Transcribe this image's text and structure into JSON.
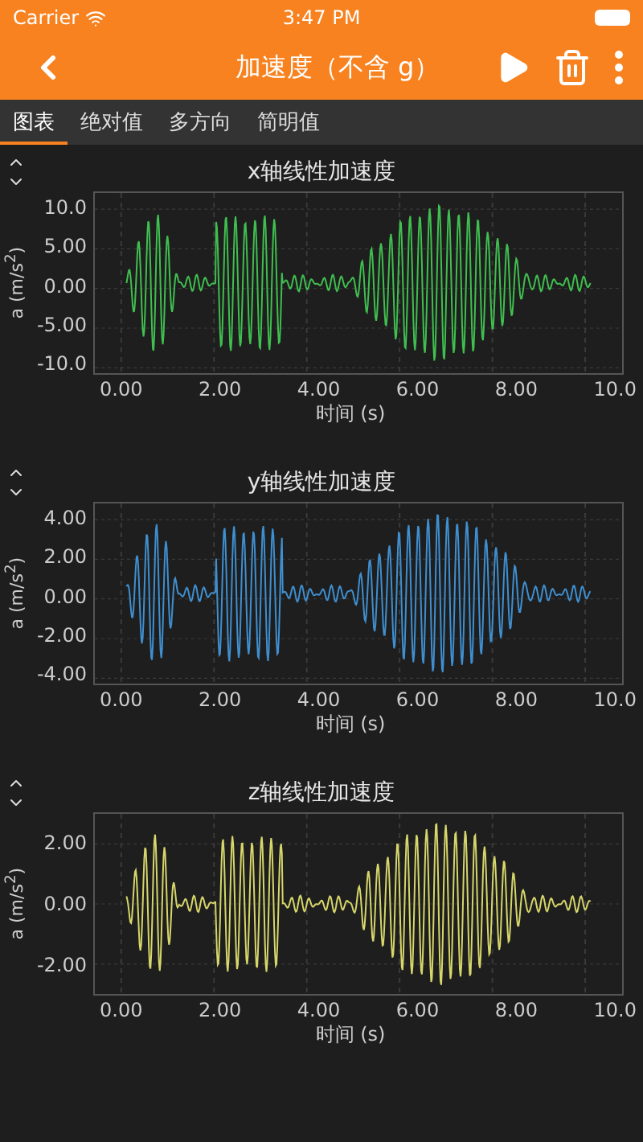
{
  "status_bar": {
    "carrier": "Carrier",
    "time": "3:47 PM"
  },
  "nav_bar": {
    "title": "加速度（不含 g）"
  },
  "tabs": [
    {
      "label": "图表",
      "selected": true
    },
    {
      "label": "绝对值",
      "selected": false
    },
    {
      "label": "多方向",
      "selected": false
    },
    {
      "label": "简明值",
      "selected": false
    }
  ],
  "graphs": [
    {
      "title": "x轴线性加速度",
      "color": "#3fbf4f",
      "ylabel": "a (m/s$^{2}$)",
      "yticks": [
        "10.0",
        "5.00",
        "0.00",
        "-5.00",
        "-10.0"
      ],
      "xticks": [
        "0.00",
        "2.00",
        "4.00",
        "6.00",
        "8.00",
        "10.0"
      ],
      "xlabel": "时间 (s)"
    },
    {
      "title": "y轴线性加速度",
      "color": "#3f8fd0",
      "ylabel": "a (m/s$^{2}$)",
      "yticks": [
        "4.00",
        "2.00",
        "0.00",
        "-2.00",
        "-4.00"
      ],
      "xticks": [
        "0.00",
        "2.00",
        "4.00",
        "6.00",
        "8.00",
        "10.0"
      ],
      "xlabel": "时间 (s)"
    },
    {
      "title": "z轴线性加速度",
      "color": "#d6d66a",
      "ylabel": "a (m/s$^{2}$)",
      "yticks": [
        "2.00",
        "0.00",
        "-2.00"
      ],
      "xticks": [
        "0.00",
        "2.00",
        "4.00",
        "6.00",
        "8.00",
        "10.0"
      ],
      "xlabel": "时间 (s)"
    }
  ]
}
